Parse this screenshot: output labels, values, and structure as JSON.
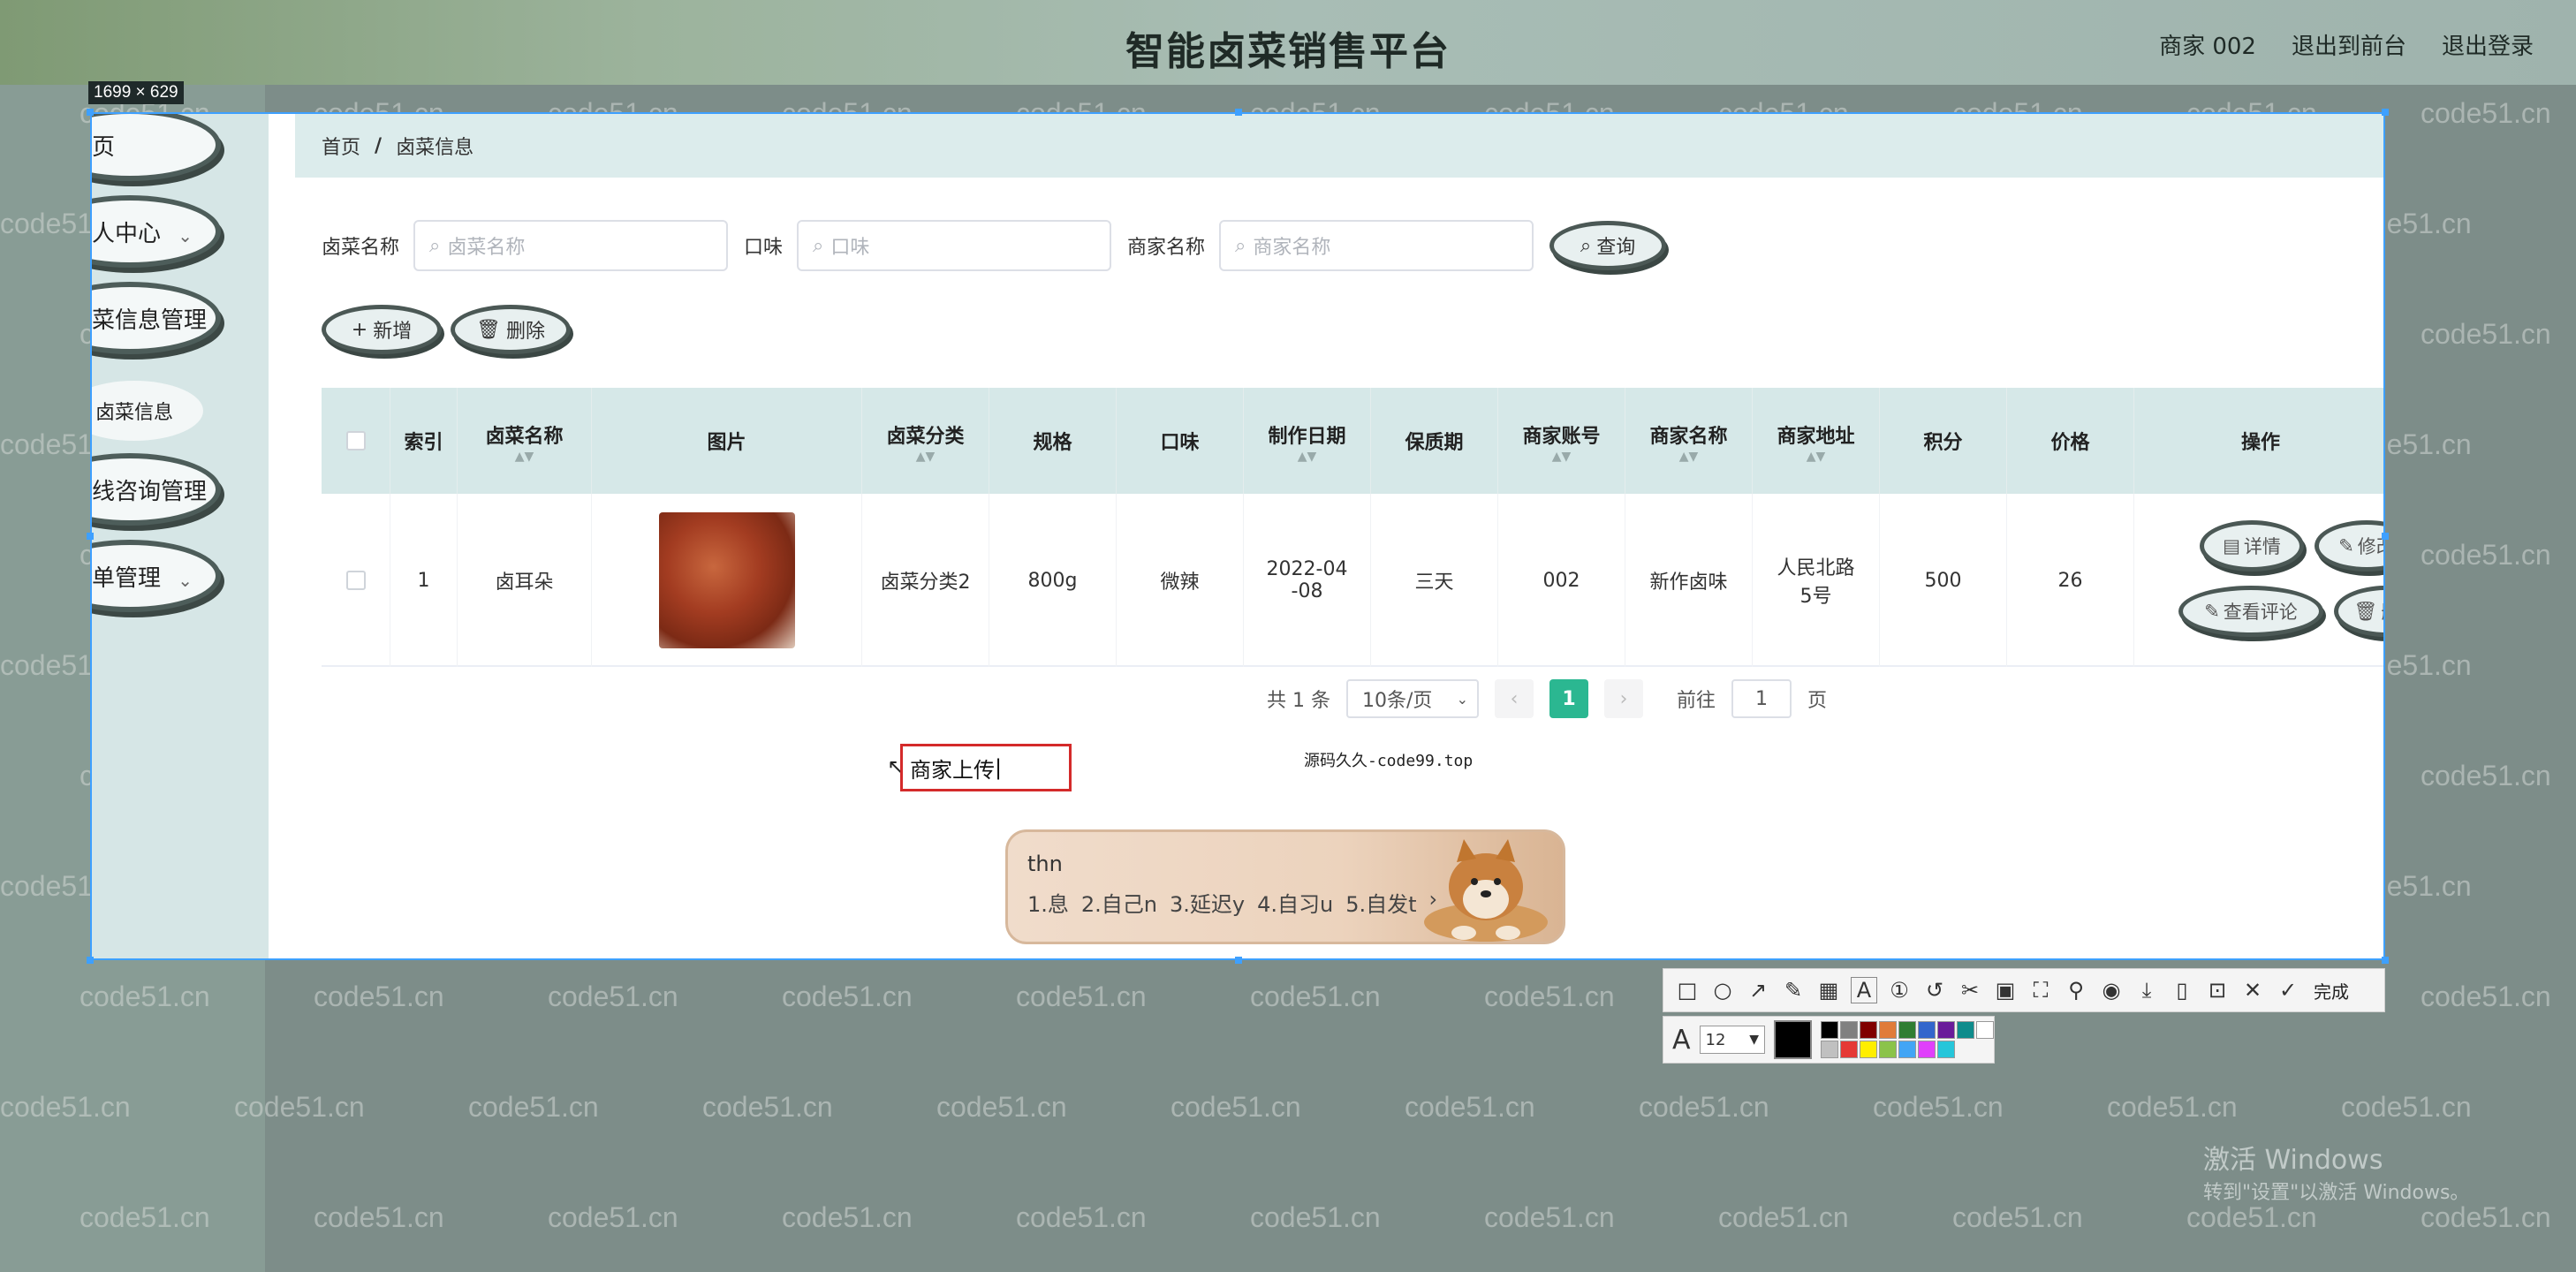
{
  "site": {
    "title": "智能卤菜销售平台"
  },
  "top_links": {
    "user": "商家 002",
    "front": "退出到前台",
    "logout": "退出登录"
  },
  "selection": {
    "dimensions": "1699 × 629"
  },
  "watermark": "code51.cn",
  "sidebar": {
    "items": [
      {
        "label": "首页",
        "chevron": false
      },
      {
        "label": "个人中心",
        "chevron": true
      },
      {
        "label": "卤菜信息管理",
        "chevron": false
      },
      {
        "label": "在线咨询管理",
        "chevron": false
      },
      {
        "label": "订单管理",
        "chevron": true
      }
    ],
    "sub_item": "卤菜信息"
  },
  "breadcrumb": {
    "home": "首页",
    "sep": "/",
    "current": "卤菜信息"
  },
  "search": {
    "name_label": "卤菜名称",
    "name_placeholder": "卤菜名称",
    "flavor_label": "口味",
    "flavor_placeholder": "口味",
    "merchant_label": "商家名称",
    "merchant_placeholder": "商家名称",
    "query_label": "查询"
  },
  "actions": {
    "add": "新增",
    "delete": "删除"
  },
  "table": {
    "headers": [
      "索引",
      "卤菜名称",
      "图片",
      "卤菜分类",
      "规格",
      "口味",
      "制作日期",
      "保质期",
      "商家账号",
      "商家名称",
      "商家地址",
      "积分",
      "价格",
      "操作"
    ],
    "rows": [
      {
        "index": "1",
        "name": "卤耳朵",
        "category": "卤菜分类2",
        "spec": "800g",
        "flavor": "微辣",
        "date": "2022-04-08",
        "shelf_life": "三天",
        "account": "002",
        "merchant": "新作卤味",
        "address": "人民北路5号",
        "points": "500",
        "price": "26"
      }
    ],
    "ops": {
      "detail": "详情",
      "edit": "修改",
      "reviews": "查看评论",
      "delete": "删除"
    }
  },
  "pager": {
    "total": "共 1 条",
    "size": "10条/页",
    "current": "1",
    "goto_label": "前往",
    "goto_value": "1",
    "page_suffix": "页"
  },
  "source_note": "源码久久-code99.top",
  "annotation": {
    "text": "商家上传"
  },
  "ime": {
    "input": "thn",
    "candidates": [
      "1.息",
      "2.自己n",
      "3.延迟y",
      "4.自习u",
      "5.自发t"
    ]
  },
  "toolbar": {
    "done_label": "完成",
    "font_size": "12"
  },
  "palette": [
    "#000000",
    "#808080",
    "#800000",
    "#e07b39",
    "#2f7d32",
    "#3366cc",
    "#6a1b9a",
    "#0f8c8c",
    "#ffffff",
    "#c0c0c0",
    "#e53935",
    "#ffee00",
    "#8bc34a",
    "#42a5f5",
    "#e040fb",
    "#26c6da"
  ],
  "windows": {
    "line1": "激活 Windows",
    "line2": "转到\"设置\"以激活 Windows。"
  }
}
